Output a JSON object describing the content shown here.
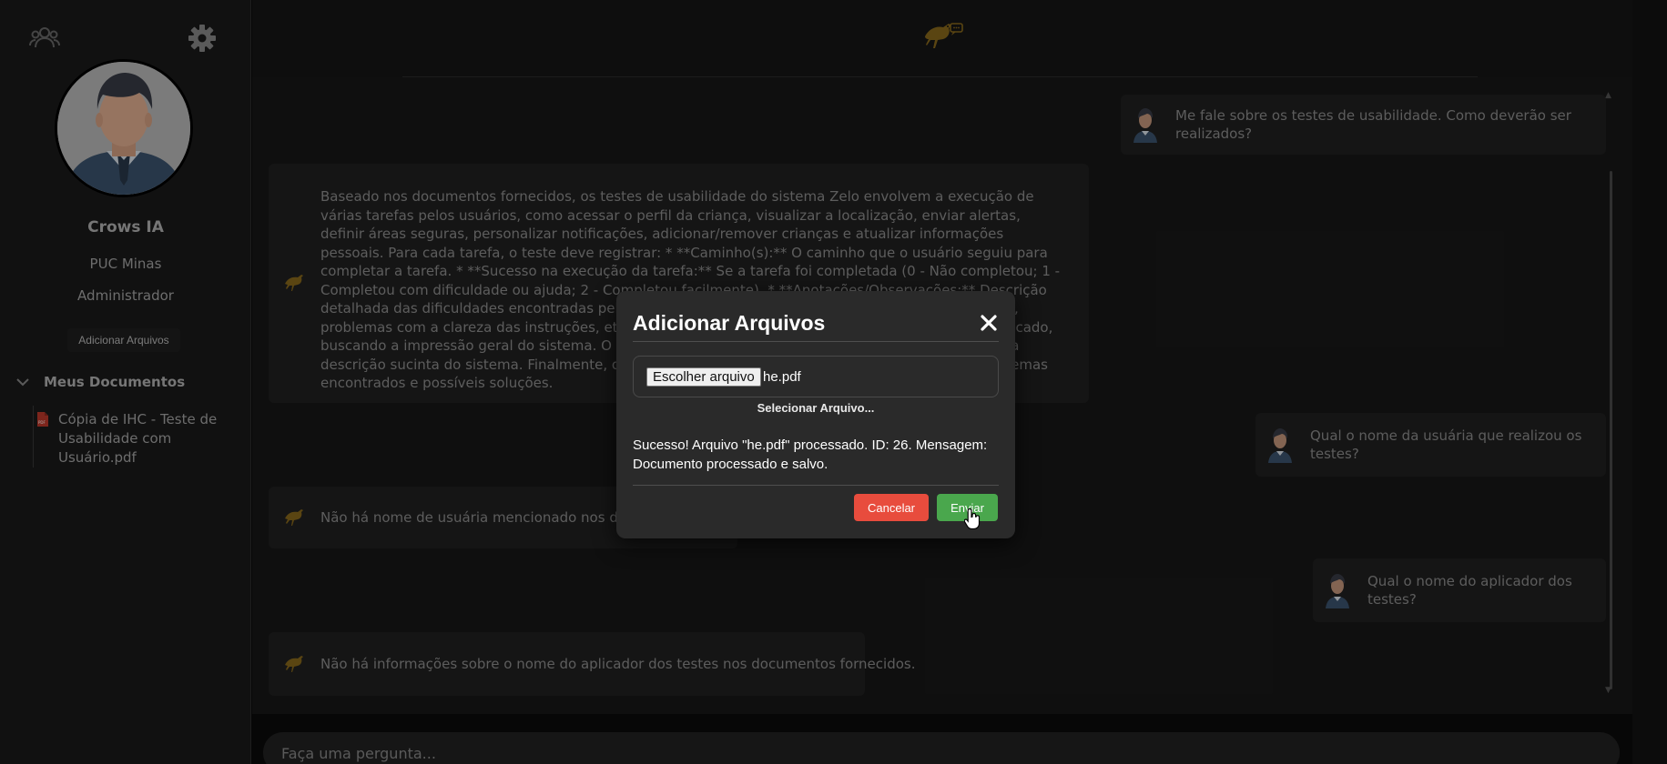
{
  "sidebar": {
    "user_name": "Crows IA",
    "organization": "PUC Minas",
    "role": "Administrador",
    "add_files_label": "Adicionar Arquivos",
    "documents_title": "Meus Documentos",
    "documents": [
      {
        "label": "Cópia de IHC - Teste de Usabilidade com Usuário.pdf",
        "icon": "pdf-file-icon"
      }
    ],
    "icons": [
      "team-icon",
      "gear-icon",
      "user-avatar",
      "chevron-down-icon"
    ]
  },
  "header": {
    "logo": "crow-logo-icon"
  },
  "messages": [
    {
      "role": "user",
      "text": "Me fale sobre os testes de usabilidade. Como deverão ser realizados?"
    },
    {
      "role": "bot",
      "text": "Baseado nos documentos fornecidos, os testes de usabilidade do sistema Zelo envolvem a execução de várias tarefas pelos usuários, como acessar o perfil da criança, visualizar a localização, enviar alertas, definir áreas seguras, personalizar notificações, adicionar/remover crianças e atualizar informações pessoais. Para cada tarefa, o teste deve registrar: * **Caminho(s):** O caminho que o usuário seguiu para completar a tarefa. * **Sucesso na execução da tarefa:** Se a tarefa foi completada (0 - Não completou; 1 - Completou com dificuldade ou ajuda; 2 - Completou facilmente). * **Anotações/Observações:** Descrição detalhada das dificuldades encontradas pelo usuário, como layout confuso, problemas de navegação, problemas com a clareza das instruções, etc. Além disso, um questionário de satisfação deve ser aplicado, buscando a impressão geral do sistema. O teste deve ser realizado com usuários que receberam uma descrição sucinta do sistema. Finalmente, o avaliador deve sintetizar os resultados, listando os problemas encontrados e possíveis soluções."
    },
    {
      "role": "user",
      "text": "Qual o nome da usuária que realizou os testes?"
    },
    {
      "role": "bot",
      "text": "Não há nome de usuária mencionado nos documentos fornecidos."
    },
    {
      "role": "user",
      "text": "Qual o nome do aplicador dos testes?"
    },
    {
      "role": "bot",
      "text": "Não há informações sobre o nome do aplicador dos testes nos documentos fornecidos."
    }
  ],
  "input": {
    "placeholder": "Faça uma pergunta..."
  },
  "modal": {
    "title": "Adicionar Arquivos",
    "close_icon": "close-icon",
    "choose_file_label": "Escolher arquivo",
    "file_name": "he.pdf",
    "select_label": "Selecionar Arquivo...",
    "status_message": "Sucesso! Arquivo \"he.pdf\" processado. ID: 26. Mensagem: Documento processado e salvo.",
    "cancel_label": "Cancelar",
    "send_label": "Enviar"
  },
  "colors": {
    "sidebar_bg": "#1b1b1b",
    "chat_bg": "#181818",
    "bubble_bg": "#212121",
    "modal_bg": "#2a2a2a",
    "cancel": "#e84c3d",
    "send": "#4aa74d",
    "accent_gold": "#8a6a1c"
  }
}
